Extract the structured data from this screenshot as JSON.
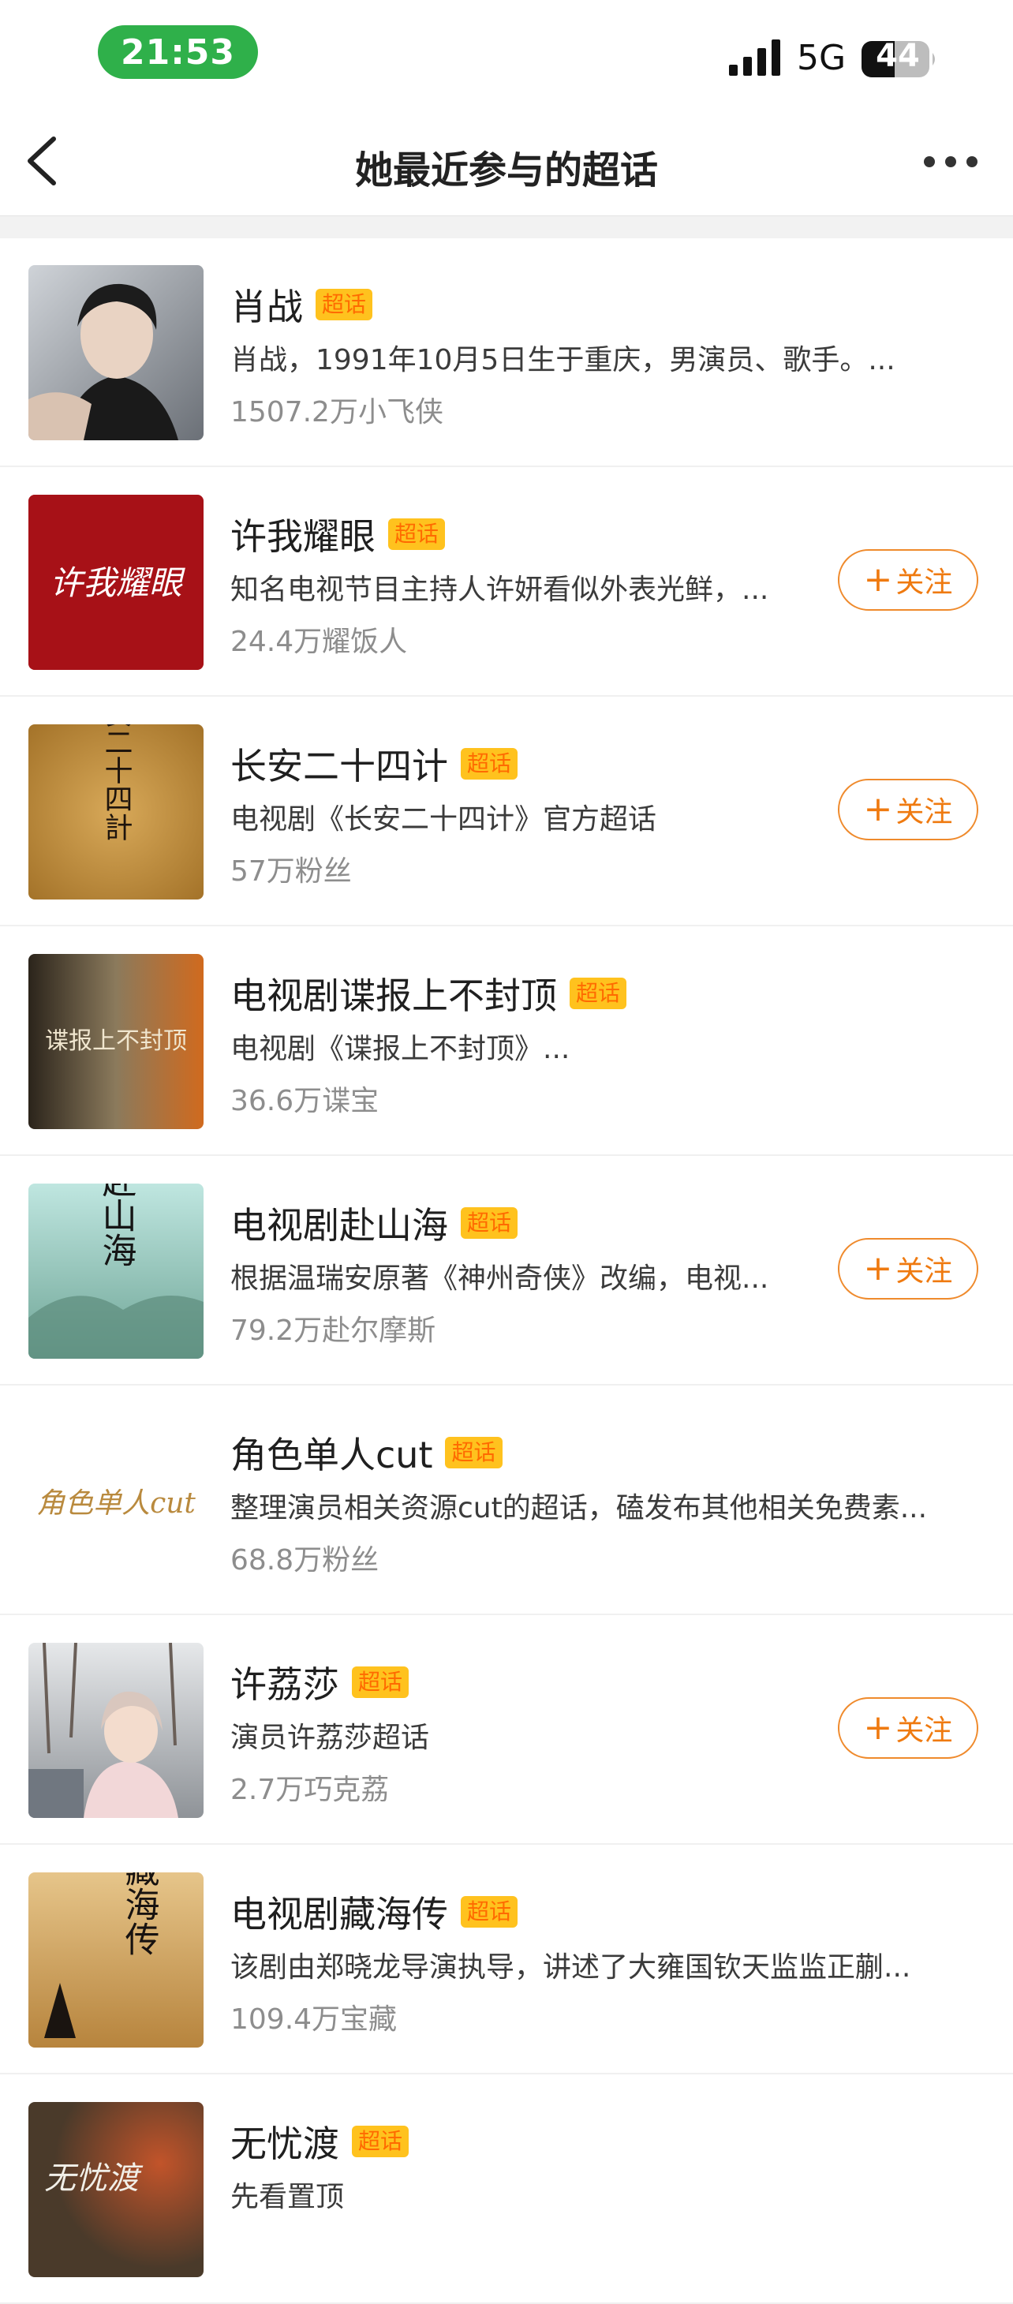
{
  "status_bar": {
    "time": "21:53",
    "network": "5G",
    "battery": "44"
  },
  "header": {
    "title": "她最近参与的超话"
  },
  "tag_label": "超话",
  "follow_label": "关注",
  "topics": [
    {
      "title": "肖战",
      "desc": "肖战，1991年10月5日生于重庆，男演员、歌手。...",
      "stats": "1507.2万小飞侠",
      "followable": false
    },
    {
      "title": "许我耀眼",
      "desc": "知名电视节目主持人许妍看似外表光鲜，...",
      "stats": "24.4万耀饭人",
      "followable": true
    },
    {
      "title": "长安二十四计",
      "desc": "电视剧《长安二十四计》官方超话",
      "stats": "57万粉丝",
      "followable": true
    },
    {
      "title": "电视剧谍报上不封顶",
      "desc": "电视剧《谍报上不封顶》...",
      "stats": "36.6万谍宝",
      "followable": false
    },
    {
      "title": "电视剧赴山海",
      "desc": "根据温瑞安原著《神州奇侠》改编，电视...",
      "stats": "79.2万赴尔摩斯",
      "followable": true
    },
    {
      "title": "角色单人cut",
      "desc": "整理演员相关资源cut的超话，磕发布其他相关免费素...",
      "stats": "68.8万粉丝",
      "followable": false
    },
    {
      "title": "许荔莎",
      "desc": "演员许荔莎超话",
      "stats": "2.7万巧克荔",
      "followable": true
    },
    {
      "title": "电视剧藏海传",
      "desc": "该剧由郑晓龙导演执导，讲述了大雍国钦天监监正蒯...",
      "stats": "109.4万宝藏",
      "followable": false
    },
    {
      "title": "无忧渡",
      "desc": "先看置顶",
      "stats": "",
      "followable": false
    }
  ],
  "thumbnails": {
    "0": {
      "art_text": ""
    },
    "1": {
      "art_text": "许我耀眼"
    },
    "2": {
      "art_text": "长安二十四計"
    },
    "3": {
      "art_text": "谍报上不封顶"
    },
    "4": {
      "art_text": "赴山海"
    },
    "5": {
      "art_text": "角色单人cut"
    },
    "6": {
      "art_text": ""
    },
    "7": {
      "art_text": "藏海传"
    },
    "8": {
      "art_text": "无忧渡"
    }
  }
}
